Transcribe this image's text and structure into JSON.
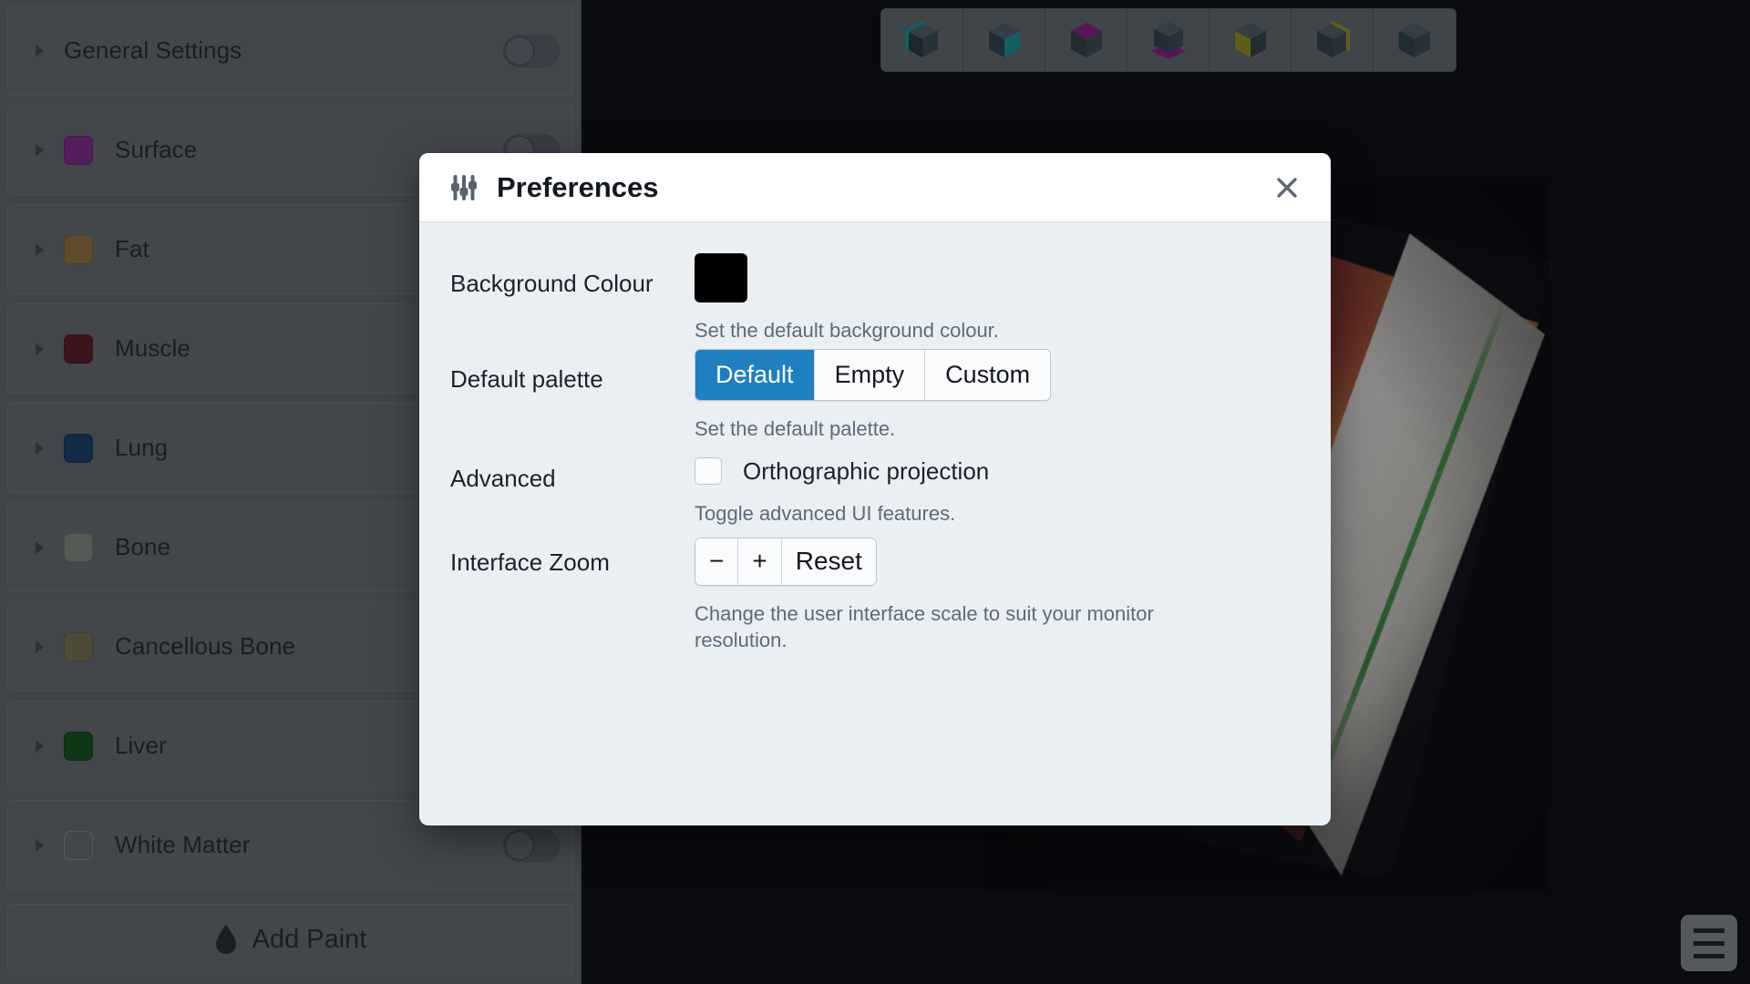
{
  "viewport": {
    "name": "3d-render-viewport",
    "background_colour": "#08080c",
    "description": "Anatomical volume rendering of a cross-sectional specimen"
  },
  "cube_toolbar": {
    "name": "view-orientation-toolbar",
    "buttons": [
      {
        "icon": "cube-edge-left-icon",
        "label": "Edge",
        "highlight": "#16888c",
        "mode": "edge"
      },
      {
        "icon": "cube-face-right-icon",
        "label": "Right Face",
        "highlight": "#16888c",
        "mode": "face-right"
      },
      {
        "icon": "cube-face-top-icon",
        "label": "Top Face",
        "highlight": "#7d1b77",
        "mode": "face-top"
      },
      {
        "icon": "cube-face-bottom-icon",
        "label": "Bottom Face",
        "highlight": "#7d1b77",
        "mode": "face-bottom"
      },
      {
        "icon": "cube-face-left-icon",
        "label": "Left Face",
        "highlight": "#8a8416",
        "mode": "face-left"
      },
      {
        "icon": "cube-edge-top-right-icon",
        "label": "Top Edge",
        "highlight": "#8a8416",
        "mode": "edge-top"
      },
      {
        "icon": "cube-plain-icon",
        "label": "Reset View",
        "highlight": "none",
        "mode": "plain"
      }
    ]
  },
  "sidebar": {
    "name": "paint-layers-sidebar",
    "layers": [
      {
        "label": "General Settings",
        "colour": null,
        "has_swatch": false,
        "toggle": "off"
      },
      {
        "label": "Surface",
        "colour": "#7a2380",
        "has_swatch": true,
        "toggle": "off"
      },
      {
        "label": "Fat",
        "colour": "#8a6a38",
        "has_swatch": true,
        "toggle": "off"
      },
      {
        "label": "Muscle",
        "colour": "#55151f",
        "has_swatch": true,
        "toggle": "off"
      },
      {
        "label": "Lung",
        "colour": "#13375e",
        "has_swatch": true,
        "toggle": "off"
      },
      {
        "label": "Bone",
        "colour": "#7a8075",
        "has_swatch": true,
        "toggle": "off"
      },
      {
        "label": "Cancellous Bone",
        "colour": "#6f6a4a",
        "has_swatch": true,
        "toggle": "off"
      },
      {
        "label": "Liver",
        "colour": "#0f4a18",
        "has_swatch": true,
        "toggle": "off"
      },
      {
        "label": "White Matter",
        "colour": null,
        "has_swatch": true,
        "toggle": "off"
      }
    ],
    "add_paint": {
      "label": "Add Paint",
      "icon": "paint-drop-icon"
    }
  },
  "dialog": {
    "name": "preferences-dialog",
    "title": "Preferences",
    "title_icon": "sliders-icon",
    "close_icon": "close-icon",
    "rows": [
      {
        "label": "Background Colour",
        "control": "colour-swatch",
        "value": "#000000",
        "hint": "Set the default background colour."
      },
      {
        "label": "Default palette",
        "control": "segmented",
        "options": [
          "Default",
          "Empty",
          "Custom"
        ],
        "selected": "Default",
        "hint": "Set the default palette."
      },
      {
        "label": "Advanced",
        "control": "checkbox",
        "checkbox_label": "Orthographic projection",
        "checked": false,
        "hint": "Toggle advanced UI features."
      },
      {
        "label": "Interface Zoom",
        "control": "button-group",
        "buttons": [
          "−",
          "+",
          "Reset"
        ],
        "hint": "Change the user interface scale to suit your monitor resolution."
      }
    ]
  },
  "menu_fab": {
    "name": "main-menu-button",
    "icon": "hamburger-icon"
  },
  "colors": {
    "accent_blue": "#1f80bf",
    "dialog_body": "#eaeff4",
    "dialog_header": "#ffffff",
    "sidebar_bg": "#5b6065",
    "hint_text": "#5d6b7a"
  }
}
